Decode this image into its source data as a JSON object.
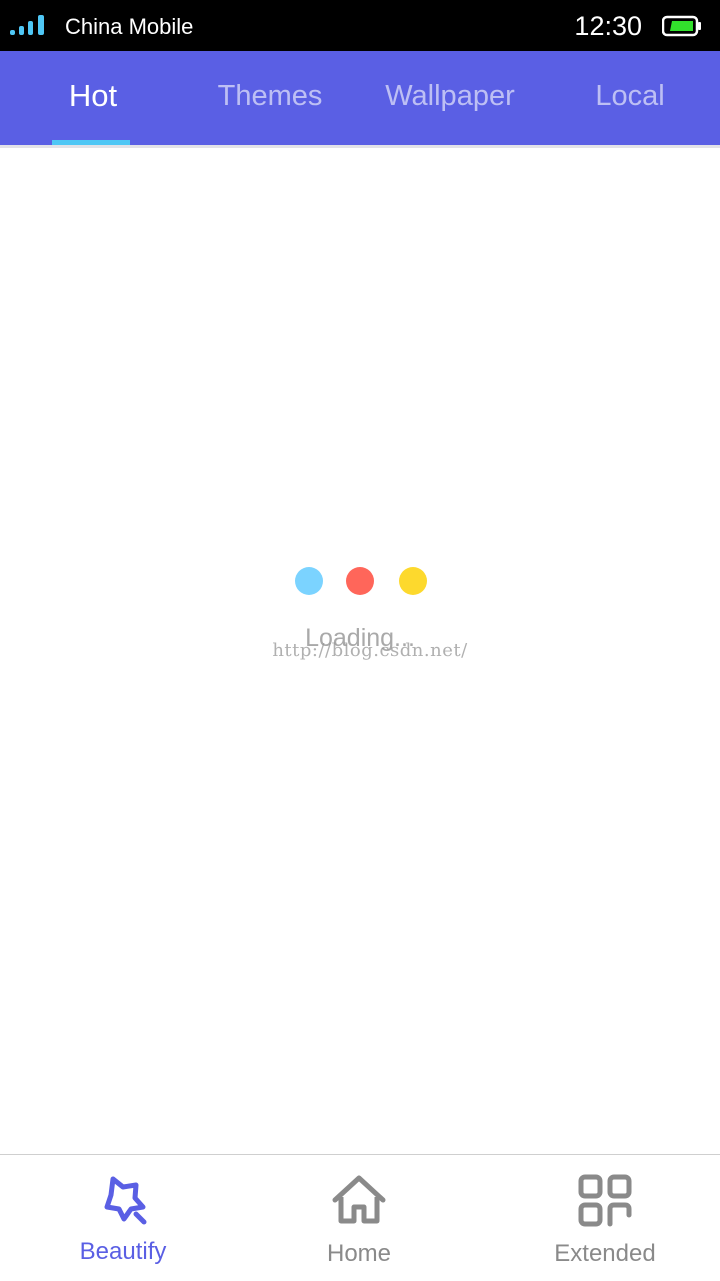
{
  "status_bar": {
    "carrier": "China Mobile",
    "time": "12:30",
    "signal_icon": "signal-bars-icon",
    "battery_icon": "battery-icon",
    "battery_color": "#32e02c",
    "signal_color": "#4fc7f5"
  },
  "tabs": [
    {
      "label": "Hot",
      "active": true
    },
    {
      "label": "Themes",
      "active": false
    },
    {
      "label": "Wallpaper",
      "active": false
    },
    {
      "label": "Local",
      "active": false
    }
  ],
  "colors": {
    "primary": "#5a5fe4",
    "indicator": "#4fc7f5",
    "loading_dots": [
      "#7bd3ff",
      "#ff665a",
      "#fdd92d"
    ]
  },
  "loading": {
    "text": "Loading...",
    "watermark": "http://blog.csdn.net/"
  },
  "bottom_nav": [
    {
      "label": "Beautify",
      "icon": "star-magic-icon",
      "active": true
    },
    {
      "label": "Home",
      "icon": "home-icon",
      "active": false
    },
    {
      "label": "Extended",
      "icon": "grid-icon",
      "active": false
    }
  ]
}
